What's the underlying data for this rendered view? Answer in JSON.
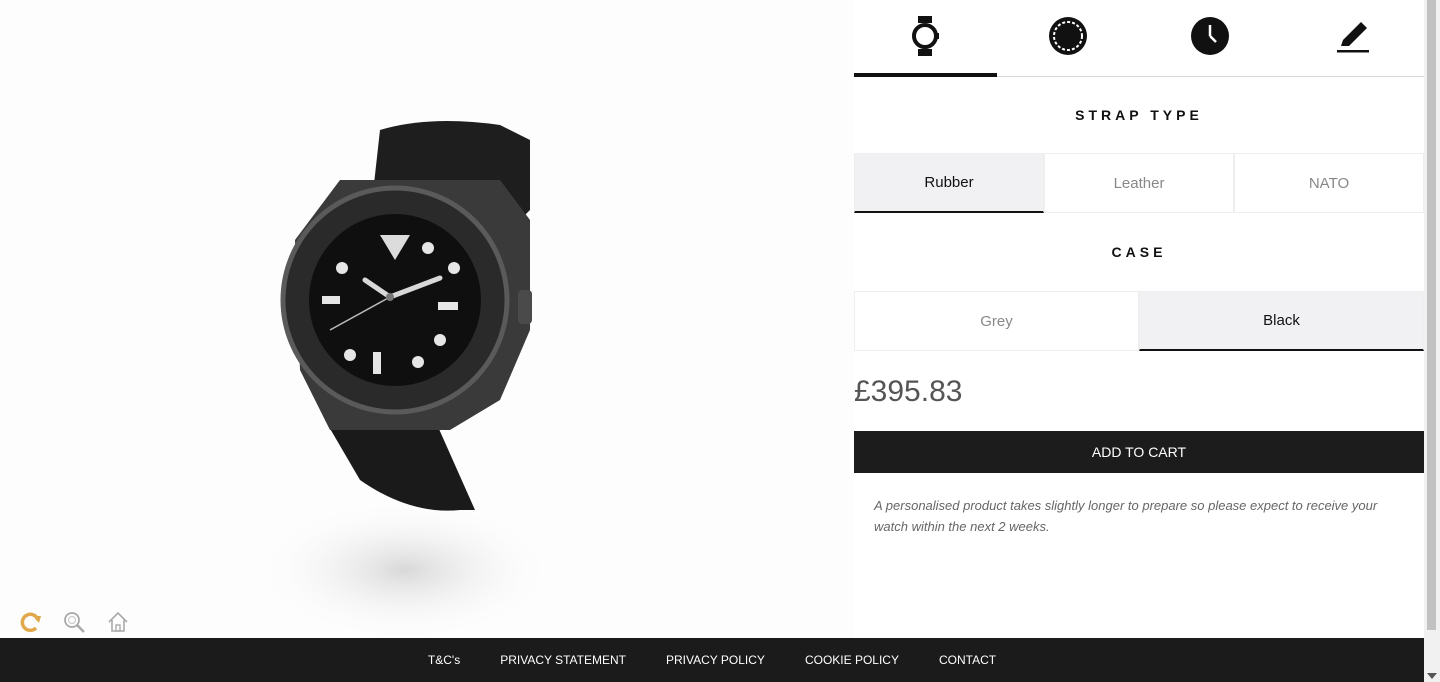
{
  "viewer": {
    "tools": [
      {
        "icon": "rotate-icon",
        "color": "#e0a84a"
      },
      {
        "icon": "zoom-icon"
      },
      {
        "icon": "home-icon"
      }
    ]
  },
  "tabs": [
    {
      "icon": "watch-icon",
      "active": true
    },
    {
      "icon": "bezel-icon",
      "active": false
    },
    {
      "icon": "dial-icon",
      "active": false
    },
    {
      "icon": "engrave-pencil-icon",
      "active": false
    }
  ],
  "strap": {
    "title": "STRAP TYPE",
    "options": [
      "Rubber",
      "Leather",
      "NATO"
    ],
    "selected": "Rubber"
  },
  "case": {
    "title": "CASE",
    "options": [
      "Grey",
      "Black"
    ],
    "selected": "Black"
  },
  "price": "£395.83",
  "cart_label": "ADD TO CART",
  "note": "A personalised product takes slightly longer to prepare so please expect to receive your watch within the next 2 weeks.",
  "footer": {
    "links": [
      "T&C's",
      "PRIVACY STATEMENT",
      "PRIVACY POLICY",
      "COOKIE POLICY",
      "CONTACT"
    ]
  },
  "colors": {
    "accent": "#e0a84a",
    "dark": "#1b1b1b",
    "selected_bg": "#f1f1f3"
  }
}
